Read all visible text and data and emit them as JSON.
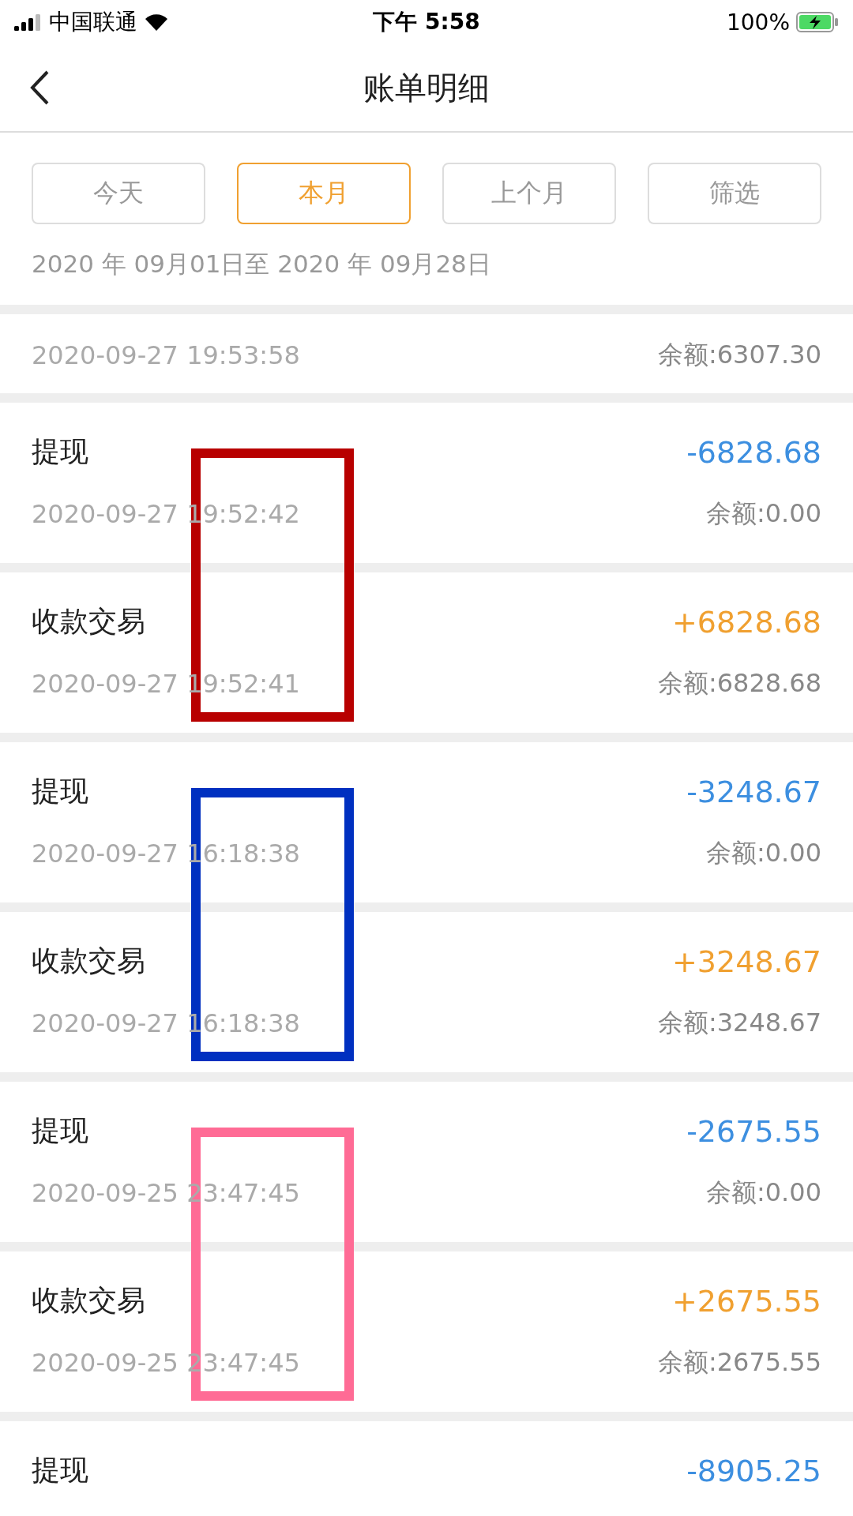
{
  "status_bar": {
    "carrier": "中国联通",
    "time": "下午 5:58",
    "battery": "100%"
  },
  "nav": {
    "title": "账单明细"
  },
  "tabs": [
    {
      "label": "今天",
      "selected": false
    },
    {
      "label": "本月",
      "selected": true
    },
    {
      "label": "上个月",
      "selected": false
    },
    {
      "label": "筛选",
      "selected": false
    }
  ],
  "date_range": "2020 年 09月01日至 2020 年 09月28日",
  "records": [
    {
      "time": "2020-09-27 19:53:58",
      "balance": "余额:6307.30"
    },
    {
      "title": "提现",
      "amount": "-6828.68",
      "kind": "out",
      "time": "2020-09-27 19:52:42",
      "balance": "余额:0.00",
      "highlight": {
        "color": "#b80000"
      }
    },
    {
      "title": "收款交易",
      "amount": "+6828.68",
      "kind": "in",
      "time": "2020-09-27 19:52:41",
      "balance": "余额:6828.68"
    },
    {
      "title": "提现",
      "amount": "-3248.67",
      "kind": "out",
      "time": "2020-09-27 16:18:38",
      "balance": "余额:0.00",
      "highlight": {
        "color": "#0030c0"
      }
    },
    {
      "title": "收款交易",
      "amount": "+3248.67",
      "kind": "in",
      "time": "2020-09-27 16:18:38",
      "balance": "余额:3248.67"
    },
    {
      "title": "提现",
      "amount": "-2675.55",
      "kind": "out",
      "time": "2020-09-25 23:47:45",
      "balance": "余额:0.00",
      "highlight": {
        "color": "#ff6b95"
      }
    },
    {
      "title": "收款交易",
      "amount": "+2675.55",
      "kind": "in",
      "time": "2020-09-25 23:47:45",
      "balance": "余额:2675.55"
    },
    {
      "title": "提现",
      "amount": "-8905.25",
      "kind": "out"
    }
  ]
}
